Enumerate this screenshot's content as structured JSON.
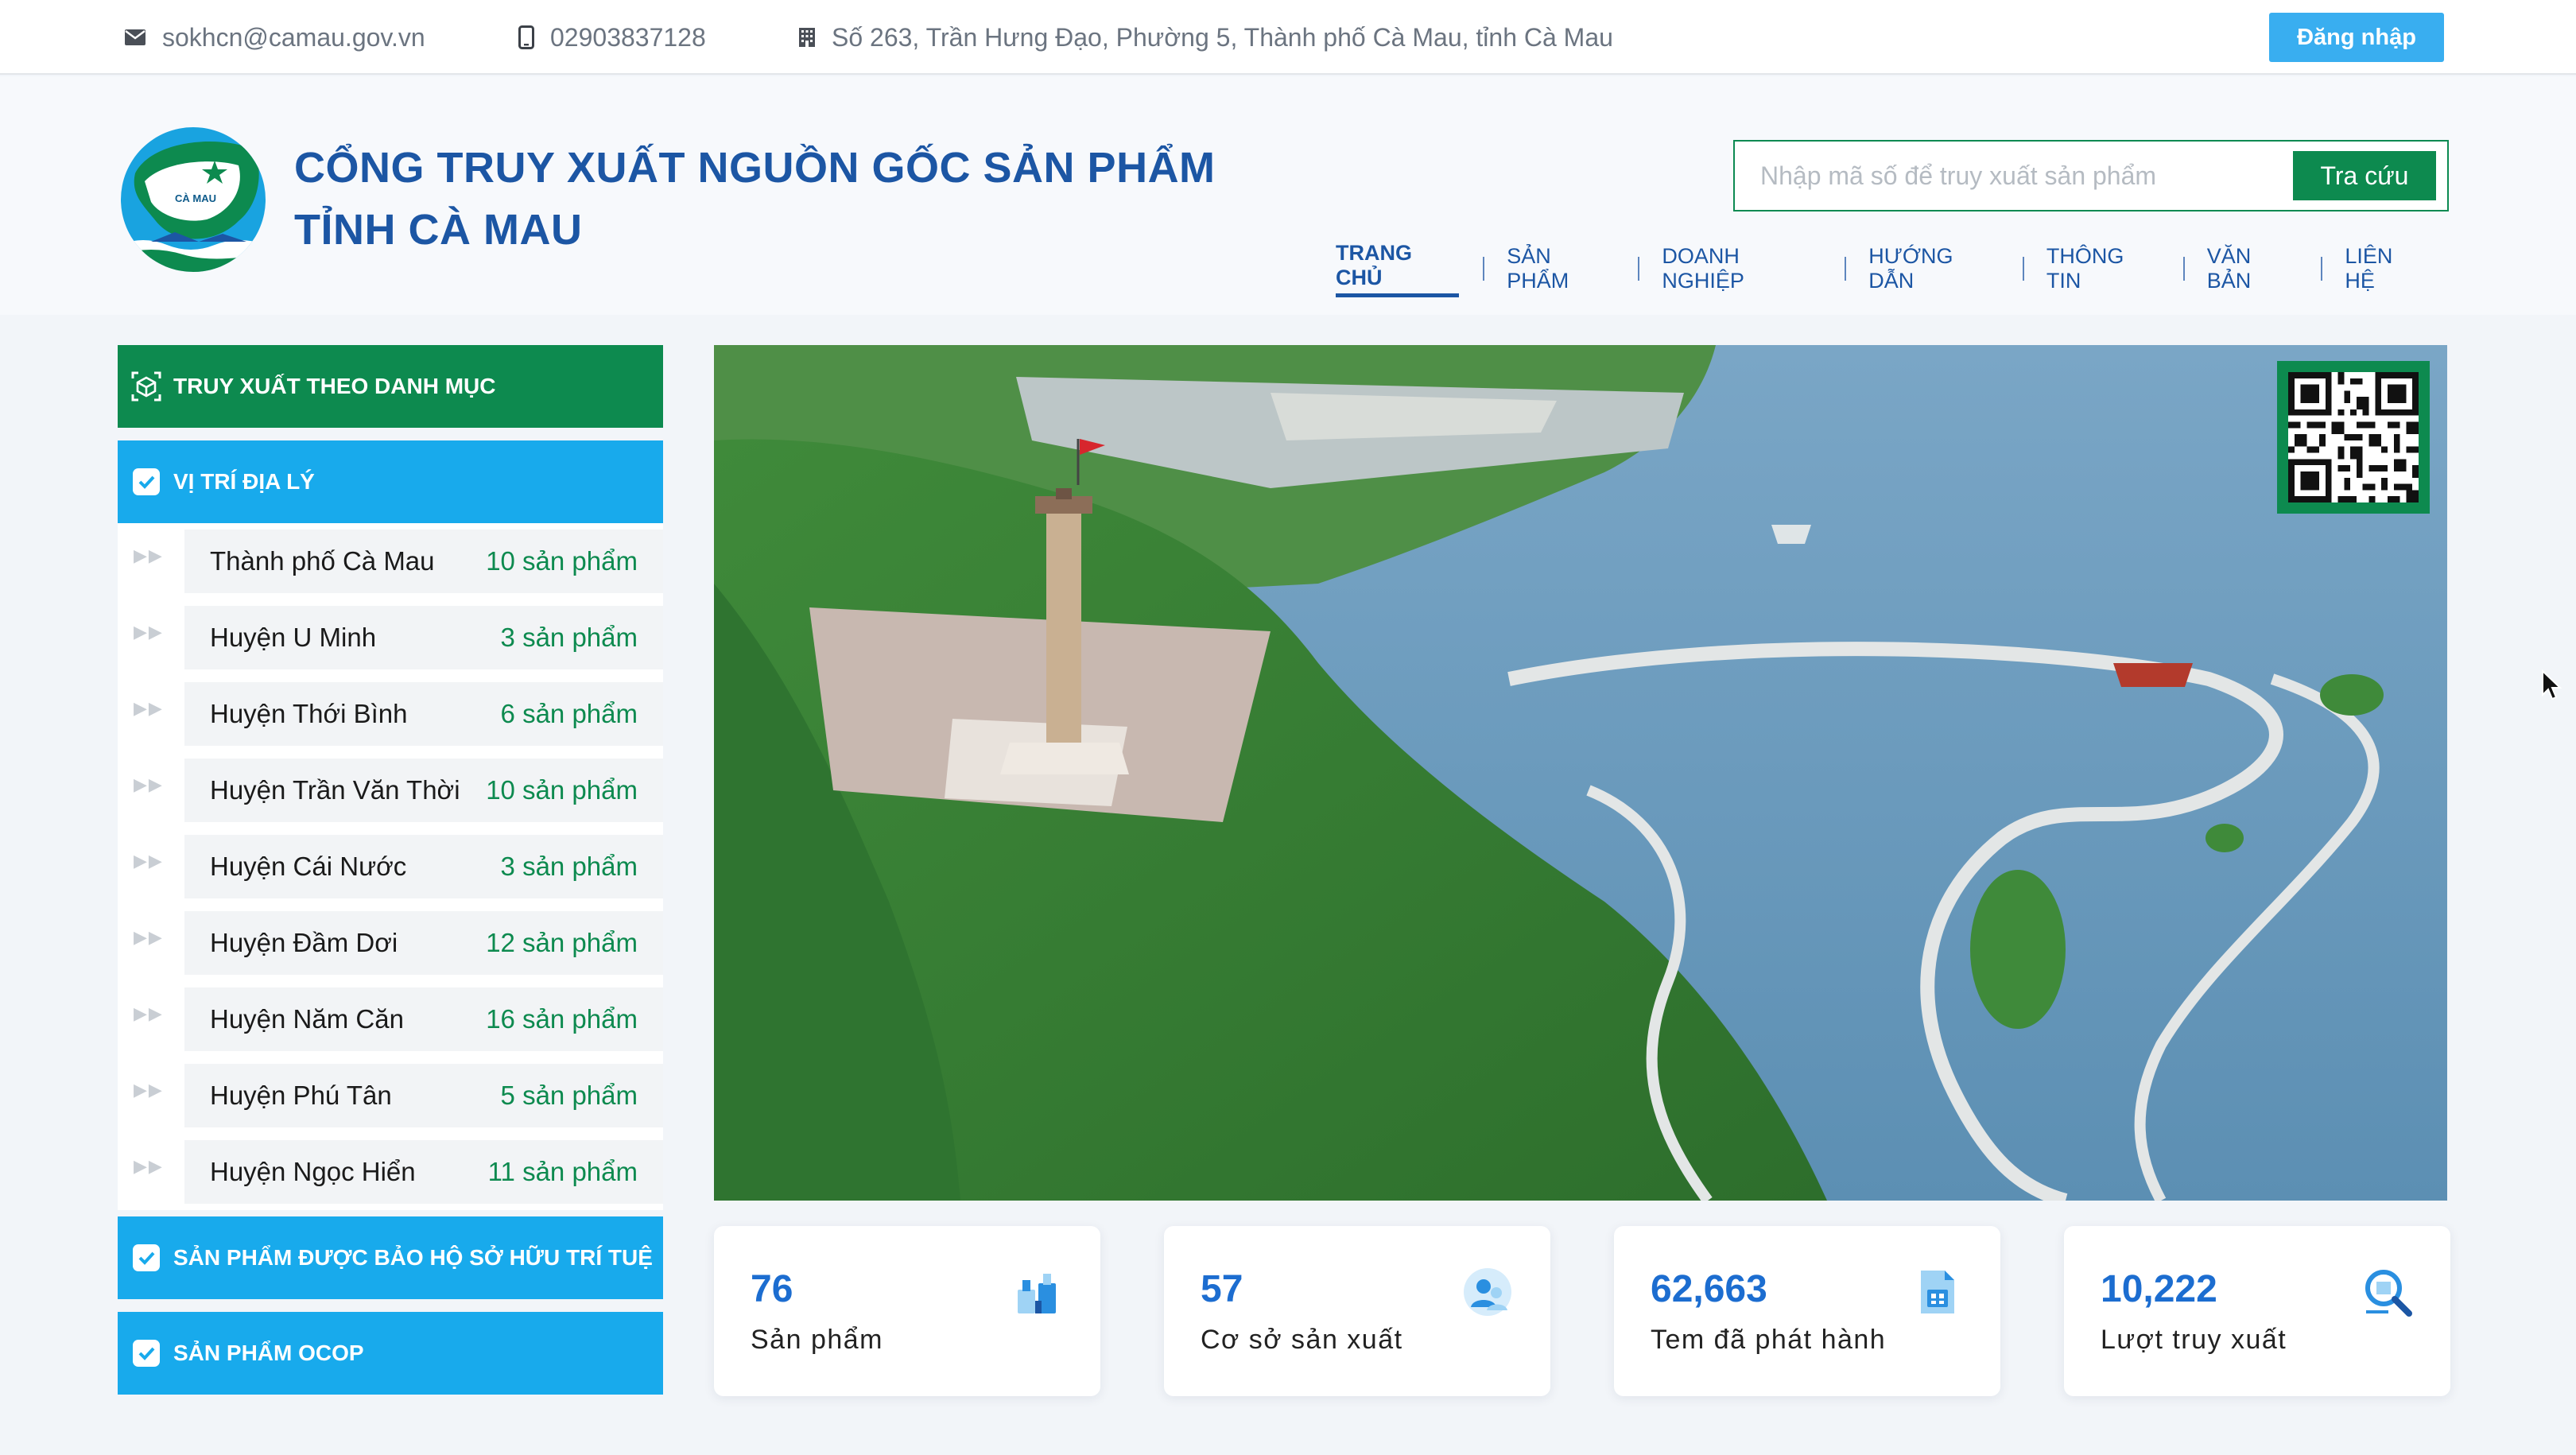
{
  "topbar": {
    "email": "sokhcn@camau.gov.vn",
    "phone": "02903837128",
    "address": "Số 263, Trần Hưng Đạo, Phường 5, Thành phố Cà Mau, tỉnh Cà Mau",
    "login_label": "Đăng nhập"
  },
  "header": {
    "title_line1": "CỔNG TRUY XUẤT NGUỒN GỐC SẢN PHẨM",
    "title_line2": "TỈNH CÀ MAU",
    "logo_text": "CÀ MAU",
    "search_placeholder": "Nhập mã số để truy xuất sản phẩm",
    "search_button": "Tra cứu"
  },
  "nav": [
    {
      "label": "TRANG CHỦ",
      "active": true
    },
    {
      "label": "SẢN PHẨM"
    },
    {
      "label": "DOANH NGHIỆP"
    },
    {
      "label": "HƯỚNG DẪN"
    },
    {
      "label": "THÔNG TIN"
    },
    {
      "label": "VĂN BẢN"
    },
    {
      "label": "LIÊN HỆ"
    }
  ],
  "sidebar": {
    "category_title": "TRUY XUẤT THEO DANH MỤC",
    "location_title": "VỊ TRÍ ĐỊA LÝ",
    "locations": [
      {
        "name": "Thành phố Cà Mau",
        "count": "10 sản phẩm"
      },
      {
        "name": "Huyện U Minh",
        "count": "3 sản phẩm"
      },
      {
        "name": "Huyện Thới Bình",
        "count": "6 sản phẩm"
      },
      {
        "name": "Huyện Trần Văn Thời",
        "count": "10 sản phẩm"
      },
      {
        "name": "Huyện Cái Nước",
        "count": "3 sản phẩm"
      },
      {
        "name": "Huyện Đầm Dơi",
        "count": "12 sản phẩm"
      },
      {
        "name": "Huyện Năm Căn",
        "count": "16 sản phẩm"
      },
      {
        "name": "Huyện Phú Tân",
        "count": "5 sản phẩm"
      },
      {
        "name": "Huyện Ngọc Hiển",
        "count": "11 sản phẩm"
      }
    ],
    "ip_title": "SẢN PHẨM ĐƯỢC BẢO HỘ SỞ HỮU TRÍ TUỆ",
    "ocop_title": "SẢN PHẨM OCOP"
  },
  "stats": [
    {
      "value": "76",
      "label": "Sản phẩm",
      "icon": "products-icon"
    },
    {
      "value": "57",
      "label": "Cơ sở sản xuất",
      "icon": "producers-icon"
    },
    {
      "value": "62,663",
      "label": "Tem đã phát hành",
      "icon": "stamp-icon"
    },
    {
      "value": "10,222",
      "label": "Lượt truy xuất",
      "icon": "trace-search-icon"
    }
  ],
  "colors": {
    "primary_blue": "#1c56a4",
    "accent_green": "#0d8a4f",
    "sky_blue": "#18aaec",
    "stat_blue": "#1c6dd0"
  }
}
